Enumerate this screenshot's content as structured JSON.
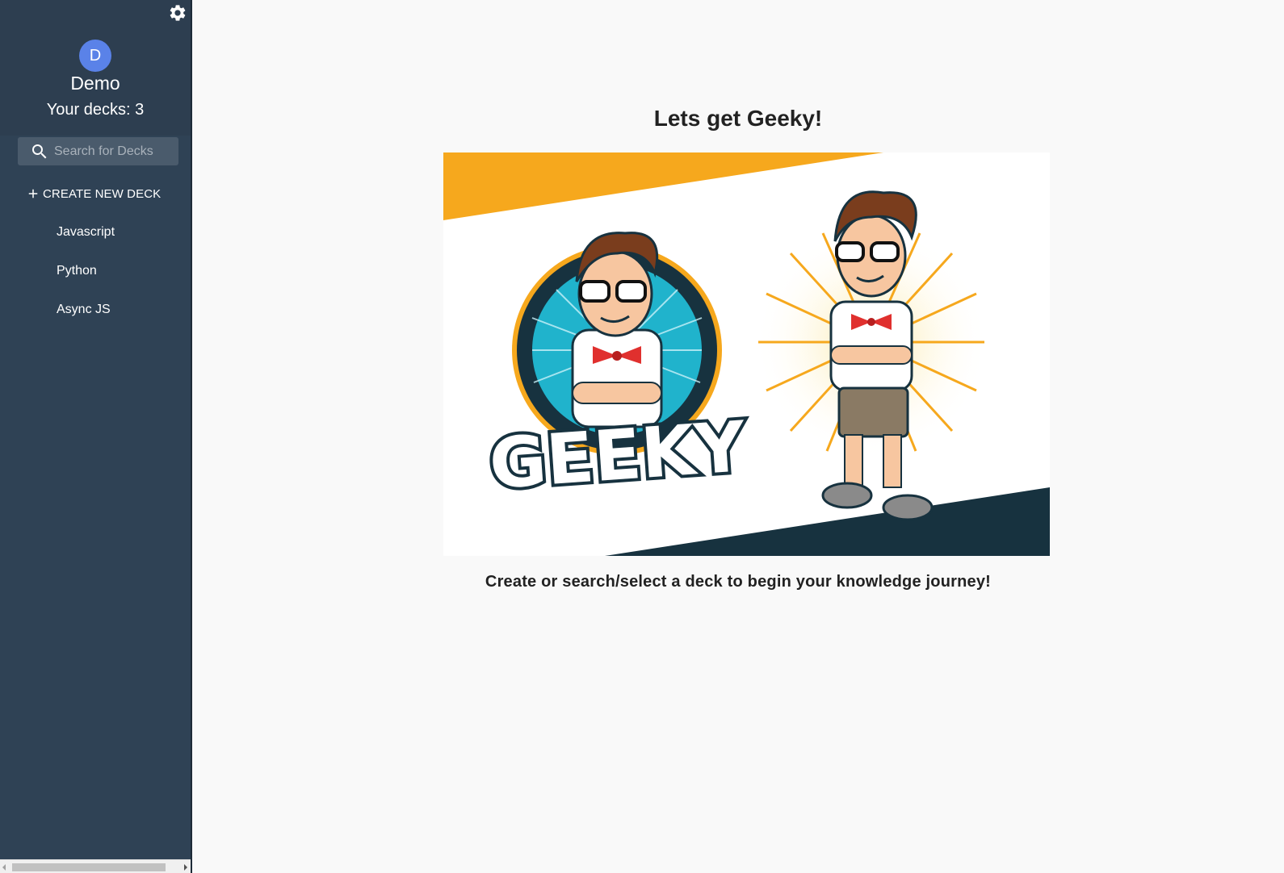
{
  "sidebar": {
    "settings_icon": "gear-icon",
    "user": {
      "avatar_initial": "D",
      "avatar_color": "#5a82e8",
      "name": "Demo",
      "deck_count_label": "Your decks: 3"
    },
    "search": {
      "icon": "search-icon",
      "placeholder": "Search for Decks",
      "value": ""
    },
    "create_button": {
      "icon": "plus-icon",
      "label": "CREATE NEW DECK"
    },
    "decks": [
      {
        "label": "Javascript"
      },
      {
        "label": "Python"
      },
      {
        "label": "Async JS"
      }
    ],
    "colors": {
      "background": "#2f4255",
      "header_background": "#2d3e50",
      "search_background": "#4a5b6c"
    }
  },
  "main": {
    "title": "Lets get Geeky!",
    "hero_image": {
      "logo_text": "GEEKY",
      "accent_orange": "#f6a81d",
      "accent_dark": "#17323f",
      "accent_teal": "#20b3cc"
    },
    "subtitle": "Create or search/select a deck to begin your knowledge journey!"
  }
}
